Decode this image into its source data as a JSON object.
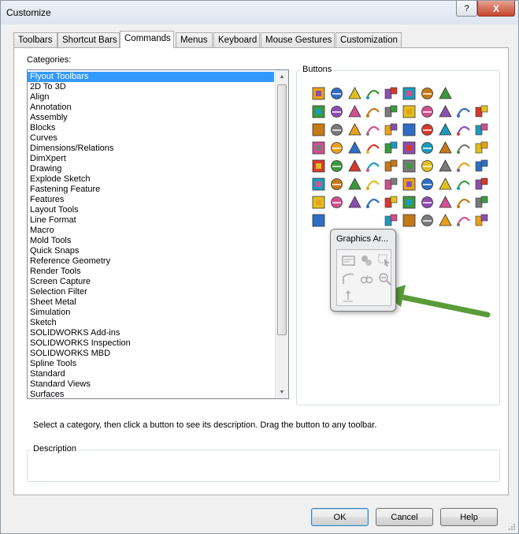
{
  "window": {
    "title": "Customize",
    "help_glyph": "?",
    "close_glyph": "X"
  },
  "tabs": [
    {
      "label": "Toolbars"
    },
    {
      "label": "Shortcut Bars"
    },
    {
      "label": "Commands",
      "active": true
    },
    {
      "label": "Menus"
    },
    {
      "label": "Keyboard"
    },
    {
      "label": "Mouse Gestures"
    },
    {
      "label": "Customization"
    }
  ],
  "categories": {
    "label": "Categories:",
    "selected": "Flyout Toolbars",
    "items": [
      "Flyout Toolbars",
      "2D To 3D",
      "Align",
      "Annotation",
      "Assembly",
      "Blocks",
      "Curves",
      "Dimensions/Relations",
      "DimXpert",
      "Drawing",
      "Explode Sketch",
      "Fastening Feature",
      "Features",
      "Layout Tools",
      "Line Format",
      "Macro",
      "Mold Tools",
      "Quick Snaps",
      "Reference Geometry",
      "Render Tools",
      "Screen Capture",
      "Selection Filter",
      "Sheet Metal",
      "Simulation",
      "Sketch",
      "SOLIDWORKS Add-ins",
      "SOLIDWORKS Inspection",
      "SOLIDWORKS MBD",
      "Spline Tools",
      "Standard",
      "Standard Views",
      "Surfaces"
    ]
  },
  "buttons_group": {
    "label": "Buttons",
    "icon_rows": [
      [
        "sketch-shapes-icon",
        "dimension-icon",
        "text-icon",
        "texture-icon",
        "spline-icon",
        "smart-dimension-icon",
        "origin-icon",
        "toolbox-icon",
        null,
        null
      ],
      [
        "assembly-icon",
        "bold-italic-icon",
        "extrude-icon",
        "line-format-icon",
        "color-grid-icon",
        "mold-icon",
        "target-icon",
        "magic-wand-icon",
        "appearance-icon",
        "palette-icon"
      ],
      [
        "selection-filter-icon",
        "camera-icon",
        "render-icon",
        "measure-icon",
        "sheet-metal-icon",
        "note-icon",
        "view-icon",
        "isometric-icon",
        "pencil-icon",
        "table-icon"
      ],
      [
        "sigma-icon",
        "simulation-icon",
        "globe-icon",
        "move-icon",
        "screw-icon",
        "new-document-icon",
        "open-folder-icon",
        "save-icon",
        "print-icon",
        "list-icon"
      ],
      [
        "construct-line-icon",
        "line-icon",
        "rectangle-icon",
        "slot-icon",
        "circle-icon",
        "arc-icon",
        "ellipse-icon",
        "spline-curve-icon",
        "fillet-icon",
        "polygon-icon"
      ],
      [
        "mirror-icon",
        "relation-icon",
        "hole-icon",
        "bolt-icon",
        "tag-icon",
        "split-icon",
        "pattern-icon",
        "block-icon",
        "weld-bead-icon",
        "assembly-tree-icon"
      ],
      [
        "insert-icon",
        "move-entities-icon",
        "rotate-icon",
        "heat-icon",
        "thermo-icon",
        "list-view-icon",
        "photo-icon",
        "waveform-icon",
        "record-icon",
        "drawing-sheet-icon"
      ],
      [
        "zoom-icon",
        null,
        null,
        null,
        "tree-icon",
        "chart-icon",
        "mesh-icon",
        "explode-icon",
        "plot-icon",
        "lock-icon"
      ]
    ]
  },
  "flyout_popup": {
    "title": "Graphics Ar...",
    "icons": [
      "view-frame-icon",
      "parts-icon",
      "cursor-select-icon",
      "curve-icon",
      "glasses-icon",
      "zoom-out-icon",
      "axis-icon"
    ]
  },
  "hint_text": "Select a category, then click a button to see its description. Drag the button to any toolbar.",
  "description": {
    "label": "Description",
    "value": ""
  },
  "footer": {
    "ok": "OK",
    "cancel": "Cancel",
    "help": "Help"
  },
  "colors": {
    "selection": "#3399ff",
    "arrow": "#5a9b3a"
  }
}
